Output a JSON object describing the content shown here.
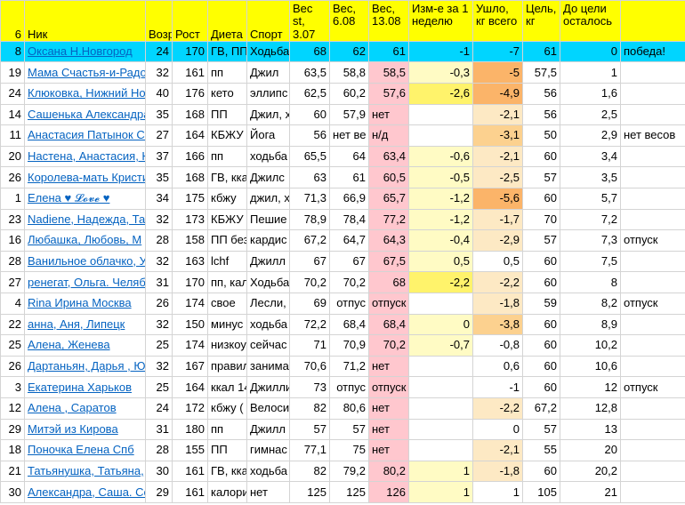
{
  "headers": {
    "idx": "6",
    "nick": "Ник",
    "age": "Возр",
    "height": "Рост",
    "diet": "Диета",
    "sport": "Спорт",
    "w_start": "Вес st, 3.07",
    "w_prev": "Вес, 6.08",
    "w_now": "Вес, 13.08",
    "change_week": "Изм-е за 1 неделю",
    "lost_total": "Ушло, кг всего",
    "goal": "Цель, кг",
    "to_goal": "До цели осталось",
    "note": ""
  },
  "rows": [
    {
      "n": "8",
      "nick": "Оксана Н.Новгород",
      "age": "24",
      "h": "170",
      "diet": "ГВ, ПП",
      "sport": "Ходьба",
      "ws": "68",
      "wp": "62",
      "wn": "61",
      "ch": "-1",
      "lost": "-7",
      "goal": "61",
      "left": "0",
      "note": "победа!"
    },
    {
      "n": "19",
      "nick": "Мама Счастья-и-Радости",
      "age": "32",
      "h": "161",
      "diet": "пп",
      "sport": "Джил",
      "ws": "63,5",
      "wp": "58,8",
      "wn": "58,5",
      "ch": "-0,3",
      "lost": "-5",
      "goal": "57,5",
      "left": "1",
      "note": ""
    },
    {
      "n": "24",
      "nick": "Клюковка, Нижний Новгород",
      "age": "40",
      "h": "176",
      "diet": "кето",
      "sport": "эллипс",
      "ws": "62,5",
      "wp": "60,2",
      "wn": "57,6",
      "ch": "-2,6",
      "lost": "-4,9",
      "goal": "56",
      "left": "1,6",
      "note": ""
    },
    {
      "n": "14",
      "nick": "Сашенька Александра",
      "age": "35",
      "h": "168",
      "diet": "ПП",
      "sport": "Джил, х",
      "ws": "60",
      "wp": "57,9",
      "wn": "нет",
      "ch": "",
      "lost": "-2,1",
      "goal": "56",
      "left": "2,5",
      "note": ""
    },
    {
      "n": "11",
      "nick": "Анастасия Патынок Са",
      "age": "27",
      "h": "164",
      "diet": "КБЖУ 1",
      "sport": "Йога",
      "ws": "56",
      "wp": "нет ве",
      "wn": "н/д",
      "ch": "",
      "lost": "-3,1",
      "goal": "50",
      "left": "2,9",
      "note": "нет весов"
    },
    {
      "n": "20",
      "nick": "Настена, Анастасия, Н",
      "age": "37",
      "h": "166",
      "diet": "пп",
      "sport": "ходьба",
      "ws": "65,5",
      "wp": "64",
      "wn": "63,4",
      "ch": "-0,6",
      "lost": "-2,1",
      "goal": "60",
      "left": "3,4",
      "note": ""
    },
    {
      "n": "26",
      "nick": "Королева-мать Кристи",
      "age": "35",
      "h": "168",
      "diet": "ГВ, кка",
      "sport": "Джилс",
      "ws": "63",
      "wp": "61",
      "wn": "60,5",
      "ch": "-0,5",
      "lost": "-2,5",
      "goal": "57",
      "left": "3,5",
      "note": ""
    },
    {
      "n": "1",
      "nick": "Елена ♥ 𝓛𝓸𝓿𝓮 ♥",
      "age": "34",
      "h": "175",
      "diet": "кбжу",
      "sport": "джил, х",
      "ws": "71,3",
      "wp": "66,9",
      "wn": "65,7",
      "ch": "-1,2",
      "lost": "-5,6",
      "goal": "60",
      "left": "5,7",
      "note": ""
    },
    {
      "n": "23",
      "nick": "Nadiene, Надежда, Та",
      "age": "32",
      "h": "173",
      "diet": "КБЖУ 1",
      "sport": "Пешие",
      "ws": "78,9",
      "wp": "78,4",
      "wn": "77,2",
      "ch": "-1,2",
      "lost": "-1,7",
      "goal": "70",
      "left": "7,2",
      "note": ""
    },
    {
      "n": "16",
      "nick": "Любашка, Любовь, М",
      "age": "28",
      "h": "158",
      "diet": "ПП без",
      "sport": "кардис",
      "ws": "67,2",
      "wp": "64,7",
      "wn": "64,3",
      "ch": "-0,4",
      "lost": "-2,9",
      "goal": "57",
      "left": "7,3",
      "note": "отпуск"
    },
    {
      "n": "28",
      "nick": "Ванильное облачко, У",
      "age": "32",
      "h": "163",
      "diet": "lchf",
      "sport": "Джилл",
      "ws": "67",
      "wp": "67",
      "wn": "67,5",
      "ch": "0,5",
      "lost": "0,5",
      "goal": "60",
      "left": "7,5",
      "note": ""
    },
    {
      "n": "27",
      "nick": "ренегат, Ольга. Челяб",
      "age": "31",
      "h": "170",
      "diet": "пп, кал",
      "sport": "Ходьба",
      "ws": "70,2",
      "wp": "70,2",
      "wn": "68",
      "ch": "-2,2",
      "lost": "-2,2",
      "goal": "60",
      "left": "8",
      "note": ""
    },
    {
      "n": "4",
      "nick": "Rina Ирина Москва",
      "age": "26",
      "h": "174",
      "diet": "свое",
      "sport": "Лесли,",
      "ws": "69",
      "wp": "отпус",
      "wn": "отпуск",
      "ch": "",
      "lost": "-1,8",
      "goal": "59",
      "left": "8,2",
      "note": "отпуск"
    },
    {
      "n": "22",
      "nick": "анна, Аня, Липецк",
      "age": "32",
      "h": "150",
      "diet": "минус",
      "sport": "ходьба",
      "ws": "72,2",
      "wp": "68,4",
      "wn": "68,4",
      "ch": "0",
      "lost": "-3,8",
      "goal": "60",
      "left": "8,9",
      "note": ""
    },
    {
      "n": "25",
      "nick": "Алена, Женева",
      "age": "25",
      "h": "174",
      "diet": "низкоу",
      "sport": "сейчас",
      "ws": "71",
      "wp": "70,9",
      "wn": "70,2",
      "ch": "-0,7",
      "lost": "-0,8",
      "goal": "60",
      "left": "10,2",
      "note": ""
    },
    {
      "n": "26",
      "nick": "Дартаньян, Дарья , Ю",
      "age": "32",
      "h": "167",
      "diet": "правил",
      "sport": "занима",
      "ws": "70,6",
      "wp": "71,2",
      "wn": "нет",
      "ch": "",
      "lost": "0,6",
      "goal": "60",
      "left": "10,6",
      "note": ""
    },
    {
      "n": "3",
      "nick": "Екатерина Харьков",
      "age": "25",
      "h": "164",
      "diet": "ккал 14",
      "sport": "Джилли",
      "ws": "73",
      "wp": "отпус",
      "wn": "отпуск",
      "ch": "",
      "lost": "-1",
      "goal": "60",
      "left": "12",
      "note": "отпуск"
    },
    {
      "n": "12",
      "nick": "Алена , Саратов",
      "age": "24",
      "h": "172",
      "diet": "кбжу (",
      "sport": "Велоси",
      "ws": "82",
      "wp": "80,6",
      "wn": "нет",
      "ch": "",
      "lost": "-2,2",
      "goal": "67,2",
      "left": "12,8",
      "note": ""
    },
    {
      "n": "29",
      "nick": "Митэй из Кирова",
      "age": "31",
      "h": "180",
      "diet": "пп",
      "sport": "Джилл",
      "ws": "57",
      "wp": "57",
      "wn": "нет",
      "ch": "",
      "lost": "0",
      "goal": "57",
      "left": "13",
      "note": ""
    },
    {
      "n": "18",
      "nick": "Поночка Елена Спб",
      "age": "28",
      "h": "155",
      "diet": "ПП",
      "sport": "гимнас",
      "ws": "77,1",
      "wp": "75",
      "wn": "нет",
      "ch": "",
      "lost": "-2,1",
      "goal": "55",
      "left": "20",
      "note": ""
    },
    {
      "n": "21",
      "nick": "Татьянушка, Татьяна,",
      "age": "30",
      "h": "161",
      "diet": "ГВ, кка",
      "sport": "ходьба",
      "ws": "82",
      "wp": "79,2",
      "wn": "80,2",
      "ch": "1",
      "lost": "-1,8",
      "goal": "60",
      "left": "20,2",
      "note": ""
    },
    {
      "n": "30",
      "nick": "Александра, Саша. Се",
      "age": "29",
      "h": "161",
      "diet": "калори",
      "sport": "нет",
      "ws": "125",
      "wp": "125",
      "wn": "126",
      "ch": "1",
      "lost": "1",
      "goal": "105",
      "left": "21",
      "note": ""
    }
  ],
  "colors": {
    "header": "#ffff00",
    "winner_row": "#00d5ff",
    "weight_now": "#ffc7ce",
    "link": "#0563c1"
  }
}
